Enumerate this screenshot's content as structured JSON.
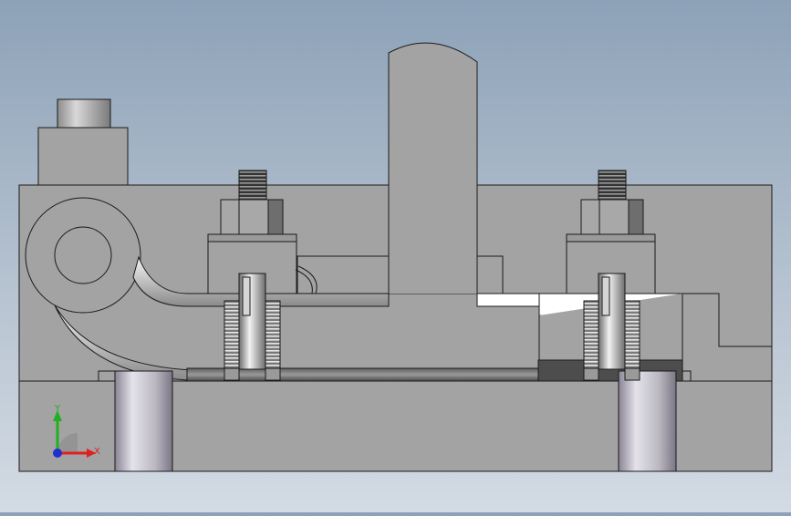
{
  "viewport": {
    "background_top": "#8da2b8",
    "background_bottom": "#d3dbe4"
  },
  "model": {
    "body_color": "#a3a3a3",
    "edge_color": "#1a1a1a",
    "cavity_color": "#ffffff",
    "steel_light": "#e6e6e6",
    "steel_dark": "#5c5c5c"
  },
  "triad": {
    "x_label": "X",
    "y_label": "Y",
    "x_color": "#e02020",
    "y_color": "#20b020",
    "z_color": "#2030d0"
  }
}
